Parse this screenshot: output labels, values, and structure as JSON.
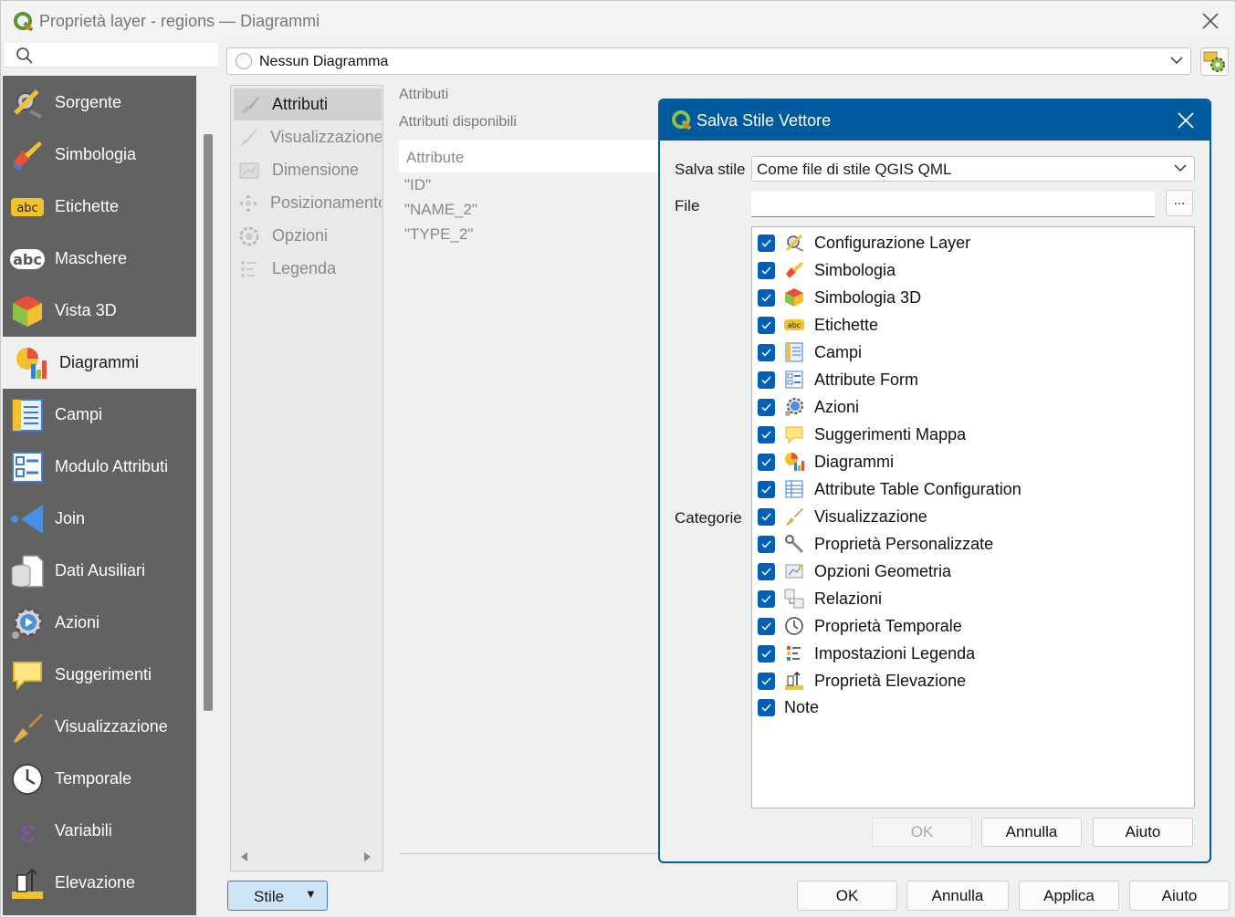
{
  "window": {
    "title": "Proprietà layer - regions — Diagrammi"
  },
  "sidebar": {
    "search_placeholder": "",
    "items": [
      {
        "label": "Sorgente",
        "icon": "settings-tools-icon"
      },
      {
        "label": "Simbologia",
        "icon": "paint-brush-icon"
      },
      {
        "label": "Etichette",
        "icon": "abc-label-icon"
      },
      {
        "label": "Maschere",
        "icon": "abc-mask-icon"
      },
      {
        "label": "Vista 3D",
        "icon": "cube-3d-icon"
      },
      {
        "label": "Diagrammi",
        "icon": "diagram-chart-icon",
        "active": true
      },
      {
        "label": "Campi",
        "icon": "fields-table-icon"
      },
      {
        "label": "Modulo Attributi",
        "icon": "attribute-form-icon"
      },
      {
        "label": "Join",
        "icon": "join-icon"
      },
      {
        "label": "Dati Ausiliari",
        "icon": "auxiliary-data-icon"
      },
      {
        "label": "Azioni",
        "icon": "actions-gear-icon"
      },
      {
        "label": "Suggerimenti",
        "icon": "tooltip-bubble-icon"
      },
      {
        "label": "Visualizzazione",
        "icon": "display-brush-icon"
      },
      {
        "label": "Temporale",
        "icon": "clock-icon"
      },
      {
        "label": "Variabili",
        "icon": "epsilon-variable-icon"
      },
      {
        "label": "Elevazione",
        "icon": "elevation-icon"
      }
    ]
  },
  "diagram_type": {
    "selected": "Nessun Diagramma"
  },
  "sub_tabs": [
    {
      "label": "Attributi",
      "icon": "attributes-brush-icon",
      "active": true
    },
    {
      "label": "Visualizzazione",
      "icon": "rendering-brush-icon"
    },
    {
      "label": "Dimensione",
      "icon": "size-icon"
    },
    {
      "label": "Posizionamento",
      "icon": "placement-icon"
    },
    {
      "label": "Opzioni",
      "icon": "options-icon"
    },
    {
      "label": "Legenda",
      "icon": "legend-icon"
    }
  ],
  "attributes": {
    "heading": "Attributi",
    "available_label": "Attributi disponibili",
    "column_header": "Attribute",
    "rows": [
      "\"ID\"",
      "\"NAME_2\"",
      "\"TYPE_2\""
    ]
  },
  "footer": {
    "style_button": "Stile",
    "ok": "OK",
    "cancel": "Annulla",
    "apply": "Applica",
    "help": "Aiuto"
  },
  "dialog": {
    "title": "Salva Stile Vettore",
    "save_style_label": "Salva stile",
    "save_style_value": "Come file di stile QGIS QML",
    "file_label": "File",
    "file_value": "",
    "browse_label": "...",
    "categories_label": "Categorie",
    "categories": [
      {
        "label": "Configurazione Layer",
        "icon": "layer-config-icon",
        "checked": true
      },
      {
        "label": "Simbologia",
        "icon": "paint-brush-icon",
        "checked": true
      },
      {
        "label": "Simbologia 3D",
        "icon": "cube-3d-icon",
        "checked": true
      },
      {
        "label": "Etichette",
        "icon": "abc-label-icon",
        "checked": true
      },
      {
        "label": "Campi",
        "icon": "fields-table-icon",
        "checked": true
      },
      {
        "label": "Attribute Form",
        "icon": "attribute-form-icon",
        "checked": true
      },
      {
        "label": "Azioni",
        "icon": "actions-gear-icon",
        "checked": true
      },
      {
        "label": "Suggerimenti Mappa",
        "icon": "tooltip-bubble-icon",
        "checked": true
      },
      {
        "label": "Diagrammi",
        "icon": "diagram-chart-icon",
        "checked": true
      },
      {
        "label": "Attribute Table Configuration",
        "icon": "table-config-icon",
        "checked": true
      },
      {
        "label": "Visualizzazione",
        "icon": "display-brush-icon",
        "checked": true
      },
      {
        "label": "Proprietà Personalizzate",
        "icon": "wrench-icon",
        "checked": true
      },
      {
        "label": "Opzioni Geometria",
        "icon": "geometry-options-icon",
        "checked": true
      },
      {
        "label": "Relazioni",
        "icon": "relations-icon",
        "checked": true
      },
      {
        "label": "Proprietà Temporale",
        "icon": "clock-icon",
        "checked": true
      },
      {
        "label": "Impostazioni Legenda",
        "icon": "legend-icon",
        "checked": true
      },
      {
        "label": "Proprietà Elevazione",
        "icon": "elevation-icon",
        "checked": true
      },
      {
        "label": "Note",
        "icon": "",
        "checked": true
      }
    ],
    "ok": "OK",
    "cancel": "Annulla",
    "help": "Aiuto"
  }
}
